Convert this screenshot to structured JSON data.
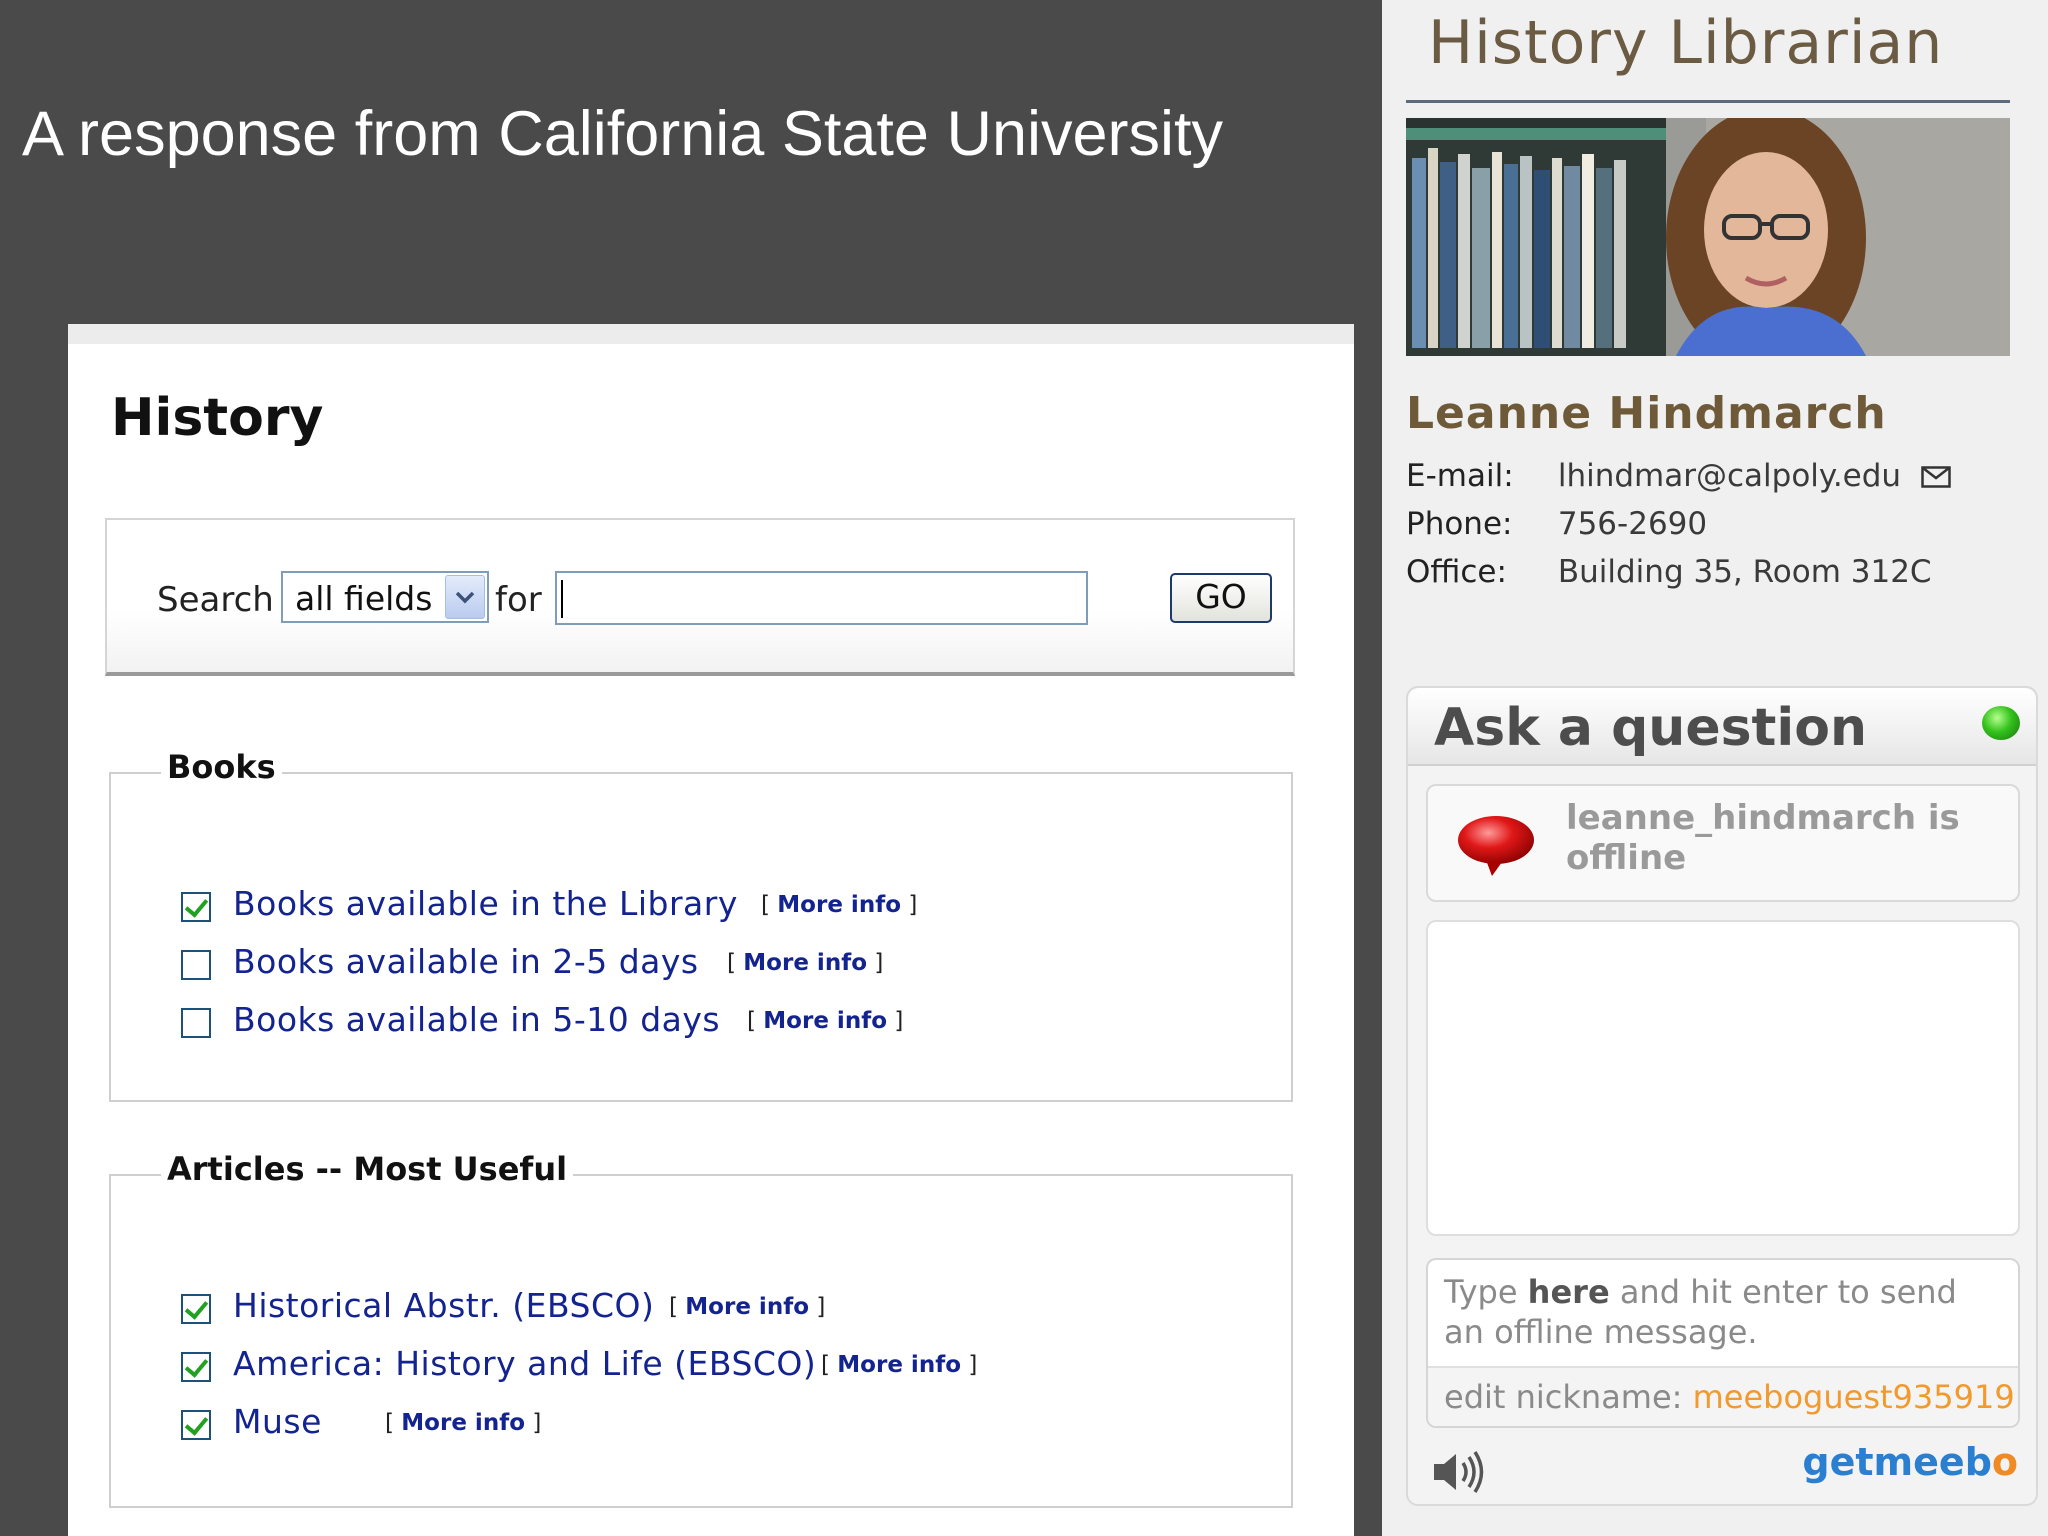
{
  "slide": {
    "title": "A response from California State University"
  },
  "search_panel": {
    "heading": "History",
    "search_label": "Search",
    "field_select_value": "all fields",
    "for_label": "for",
    "query_value": "",
    "go_label": "GO"
  },
  "books": {
    "legend": "Books",
    "items": [
      {
        "label": "Books available in the Library",
        "checked": true
      },
      {
        "label": "Books available in 2-5 days",
        "checked": false
      },
      {
        "label": "Books available in 5-10 days",
        "checked": false
      }
    ]
  },
  "articles": {
    "legend": "Articles -- Most Useful",
    "items": [
      {
        "label": "Historical Abstr. (EBSCO)",
        "checked": true
      },
      {
        "label": "America: History and Life (EBSCO)",
        "checked": true
      },
      {
        "label": "Muse",
        "checked": true
      }
    ]
  },
  "more_info": {
    "open": "[",
    "label": "More info",
    "close": "]"
  },
  "sidebar": {
    "title": "History Librarian",
    "name": "Leanne Hindmarch",
    "email_label": "E-mail:",
    "email": "lhindmar@calpoly.edu",
    "phone_label": "Phone:",
    "phone": "756-2690",
    "office_label": "Office:",
    "office": "Building 35, Room 312C"
  },
  "chat": {
    "title": "Ask a question",
    "status_text": "leanne_hindmarch is offline",
    "compose_prefix": "Type ",
    "compose_bold": "here",
    "compose_suffix": " and hit enter to send an offline message.",
    "nickname_label": "edit nickname:",
    "nickname_value": "meeboguest935919",
    "get_label": "get",
    "brand_label": "meeb",
    "brand_last": "o",
    "status_color": "#33c21c",
    "brand_color": "#2b7fd0",
    "accent_color": "#f29a2e"
  },
  "icons": [
    "chevron-down-icon",
    "checkbox-icon",
    "mail-icon",
    "online-status-icon",
    "offline-speech-bubble-icon",
    "speaker-icon"
  ]
}
